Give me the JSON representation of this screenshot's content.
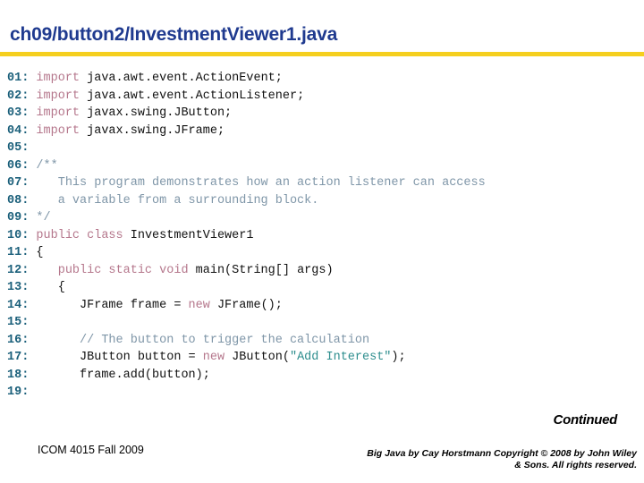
{
  "slide": {
    "title": "ch09/button2/InvestmentViewer1.java",
    "accent_title_color": "#1f3a8f",
    "accent_rule_color": "#f5cf1e"
  },
  "syntax_colors": {
    "line_number": "#1a5f7a",
    "plain": "#111111",
    "keyword": "#b5778c",
    "comment": "#7f96a8",
    "string": "#2e8e8e"
  },
  "code": {
    "lines": [
      {
        "number": "01:",
        "tokens": [
          {
            "t": " ",
            "k": "plain"
          },
          {
            "t": "import",
            "k": "kw"
          },
          {
            "t": " java.awt.event.ActionEvent;",
            "k": "plain"
          }
        ]
      },
      {
        "number": "02:",
        "tokens": [
          {
            "t": " ",
            "k": "plain"
          },
          {
            "t": "import",
            "k": "kw"
          },
          {
            "t": " java.awt.event.ActionListener;",
            "k": "plain"
          }
        ]
      },
      {
        "number": "03:",
        "tokens": [
          {
            "t": " ",
            "k": "plain"
          },
          {
            "t": "import",
            "k": "kw"
          },
          {
            "t": " javax.swing.JButton;",
            "k": "plain"
          }
        ]
      },
      {
        "number": "04:",
        "tokens": [
          {
            "t": " ",
            "k": "plain"
          },
          {
            "t": "import",
            "k": "kw"
          },
          {
            "t": " javax.swing.JFrame;",
            "k": "plain"
          }
        ]
      },
      {
        "number": "05:",
        "tokens": []
      },
      {
        "number": "06:",
        "tokens": [
          {
            "t": " /**",
            "k": "cmt"
          }
        ]
      },
      {
        "number": "07:",
        "tokens": [
          {
            "t": "    This program demonstrates how an action listener can access",
            "k": "cmt"
          }
        ]
      },
      {
        "number": "08:",
        "tokens": [
          {
            "t": "    a variable from a surrounding block.",
            "k": "cmt"
          }
        ]
      },
      {
        "number": "09:",
        "tokens": [
          {
            "t": " */",
            "k": "cmt"
          }
        ]
      },
      {
        "number": "10:",
        "tokens": [
          {
            "t": " ",
            "k": "plain"
          },
          {
            "t": "public class",
            "k": "kw"
          },
          {
            "t": " InvestmentViewer1",
            "k": "plain"
          }
        ]
      },
      {
        "number": "11:",
        "tokens": [
          {
            "t": " {",
            "k": "plain"
          }
        ]
      },
      {
        "number": "12:",
        "tokens": [
          {
            "t": "    ",
            "k": "plain"
          },
          {
            "t": "public static void",
            "k": "kw"
          },
          {
            "t": " main(String[] args)",
            "k": "plain"
          }
        ]
      },
      {
        "number": "13:",
        "tokens": [
          {
            "t": "    {",
            "k": "plain"
          }
        ]
      },
      {
        "number": "14:",
        "tokens": [
          {
            "t": "       JFrame frame = ",
            "k": "plain"
          },
          {
            "t": "new",
            "k": "kw"
          },
          {
            "t": " JFrame();",
            "k": "plain"
          }
        ]
      },
      {
        "number": "15:",
        "tokens": []
      },
      {
        "number": "16:",
        "tokens": [
          {
            "t": "       // The button to trigger the calculation",
            "k": "cmt"
          }
        ]
      },
      {
        "number": "17:",
        "tokens": [
          {
            "t": "       JButton button = ",
            "k": "plain"
          },
          {
            "t": "new",
            "k": "kw"
          },
          {
            "t": " JButton(",
            "k": "plain"
          },
          {
            "t": "\"Add Interest\"",
            "k": "str"
          },
          {
            "t": ");",
            "k": "plain"
          }
        ]
      },
      {
        "number": "18:",
        "tokens": [
          {
            "t": "       frame.add(button);",
            "k": "plain"
          }
        ]
      },
      {
        "number": "19:",
        "tokens": []
      }
    ]
  },
  "footer": {
    "continued": "Continued",
    "course": "ICOM 4015 Fall 2009",
    "copyright_line1": "Big Java by Cay Horstmann Copyright © 2008 by John Wiley",
    "copyright_line2": "& Sons.  All rights reserved."
  }
}
